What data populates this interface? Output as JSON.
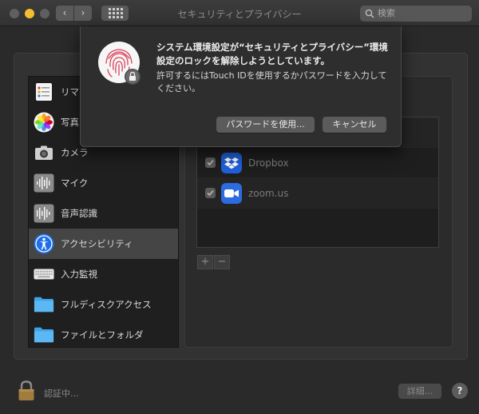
{
  "window": {
    "title": "セキュリティとプライバシー",
    "search_placeholder": "検索"
  },
  "sidebar": {
    "items": [
      {
        "label": "リマインダー",
        "icon": "reminders-icon"
      },
      {
        "label": "写真",
        "icon": "photos-icon"
      },
      {
        "label": "カメラ",
        "icon": "camera-icon"
      },
      {
        "label": "マイク",
        "icon": "microphone-icon"
      },
      {
        "label": "音声認識",
        "icon": "speech-recognition-icon"
      },
      {
        "label": "アクセシビリティ",
        "icon": "accessibility-icon",
        "selected": true
      },
      {
        "label": "入力監視",
        "icon": "keyboard-icon"
      },
      {
        "label": "フルディスクアクセス",
        "icon": "folder-icon"
      },
      {
        "label": "ファイルとフォルダ",
        "icon": "folder-icon"
      }
    ]
  },
  "apps": [
    {
      "name": "Dropbox",
      "checked": true,
      "icon": "dropbox-icon",
      "color": "#1f5fd8"
    },
    {
      "name": "zoom.us",
      "checked": true,
      "icon": "zoom-icon",
      "color": "#2d6be0"
    }
  ],
  "controls": {
    "add": "+",
    "remove": "−"
  },
  "footer": {
    "auth_text": "認証中...",
    "detail_button": "詳細...",
    "help_button": "?"
  },
  "dialog": {
    "title": "システム環境設定が“セキュリティとプライバシー”環境設定のロックを解除しようとしています。",
    "body": "許可するにはTouch IDを使用するかパスワードを入力してください。",
    "password_button": "パスワードを使用...",
    "cancel_button": "キャンセル"
  },
  "colors": {
    "accent_yellow": "#f4bd32",
    "fingerprint": "#d9405a",
    "accessibility_blue": "#1f6fe6"
  }
}
